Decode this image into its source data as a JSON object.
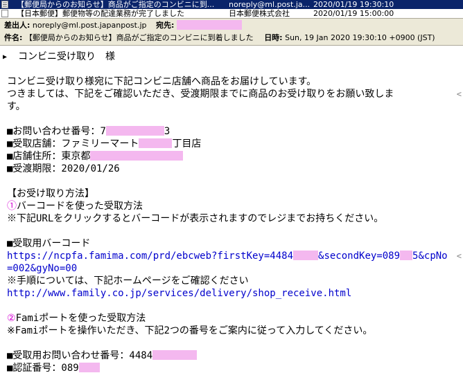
{
  "message_list": {
    "selected": {
      "subject": "【郵便局からのお知らせ】商品がご指定のコンビニに到...",
      "from": "noreply@ml.post.ja...",
      "date": "2020/01/19 19:30:10"
    },
    "other": {
      "subject": "【日本郵便】郵便物等の配達業務が完了しました",
      "from": "日本郵便株式会社",
      "date": "2020/01/19 15:00:00"
    }
  },
  "header": {
    "from_label": "差出人:",
    "from_value": "noreply@ml.post.japanpost.jp",
    "to_label": "宛先:",
    "subject_label": "件名:",
    "subject_value": "【郵便局からのお知らせ】商品がご指定のコンビニに到着しました",
    "date_label": "日時:",
    "date_value": "Sun, 19 Jan 2020 19:30:10 +0900 (JST)"
  },
  "body": {
    "greeting": "コンビニ受け取り　様",
    "p1": "コンビニ受け取り様宛に下記コンビニ店舗へ商品をお届けしています。",
    "p2a": "つきましては、下記をご確認いただき、受渡期限までに商品のお受け取りをお願い致しま",
    "p2b": "す。",
    "inquiry_label": "■お問い合わせ番号：",
    "inquiry_start": "7",
    "inquiry_end": "3",
    "store_label": "■受取店舗：ファミリーマート",
    "store_suffix": "丁目店",
    "address_label": "■店舗住所：東京都",
    "deadline": "■受渡期限：2020/01/26",
    "method_title": "【お受け取り方法】",
    "method1_num": "①",
    "method1_title": "バーコードを使った受取方法",
    "method1_note": "※下記URLをクリックするとバーコードが表示されますのでレジまでお持ちください。",
    "barcode_title": "■受取用バーコード",
    "url1_a": "https://ncpfa.famima.com/prd/ebcweb?firstKey=4484",
    "url1_b": "&secondKey=089",
    "url1_c": "5&cpNo",
    "url1_d": "=002&gyNo=00",
    "procedure_note": "※手順については、下記ホームページをご確認ください",
    "url2": "http://www.family.co.jp/services/delivery/shop_receive.html",
    "method2_num": "②",
    "method2_title": "Famiポートを使った受取方法",
    "method2_note": "※Famiポートを操作いただき、下記2つの番号をご案内に従って入力してください。",
    "recv_inquiry_label": "■受取用お問い合わせ番号：4484",
    "auth_label": "■認証番号：089"
  }
}
